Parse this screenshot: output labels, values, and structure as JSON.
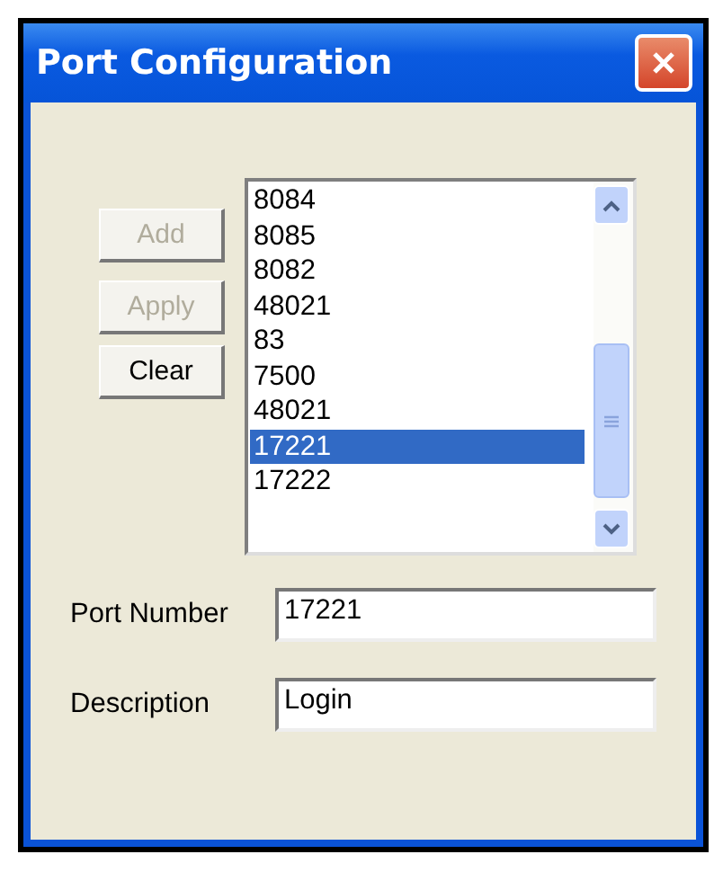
{
  "window": {
    "title": "Port Configuration"
  },
  "buttons": [
    {
      "label": "Add",
      "disabled": true
    },
    {
      "label": "Apply",
      "disabled": true
    },
    {
      "label": "Clear",
      "disabled": false
    }
  ],
  "ports": [
    {
      "label": "8084",
      "selected": false
    },
    {
      "label": "8085",
      "selected": false
    },
    {
      "label": "8082",
      "selected": false
    },
    {
      "label": "48021",
      "selected": false
    },
    {
      "label": "83",
      "selected": false
    },
    {
      "label": "7500",
      "selected": false
    },
    {
      "label": "48021",
      "selected": false
    },
    {
      "label": "17221",
      "selected": true
    },
    {
      "label": "17222",
      "selected": false
    }
  ],
  "fields": [
    {
      "label": "Port Number",
      "value": "17221"
    },
    {
      "label": "Description",
      "value": "Login"
    }
  ]
}
